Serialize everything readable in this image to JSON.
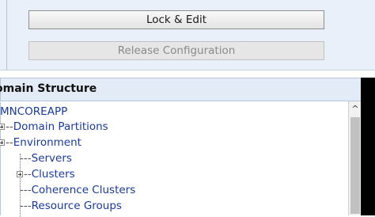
{
  "change_center": {
    "lock_edit_label": "Lock & Edit",
    "release_config_label": "Release Configuration"
  },
  "domain_structure": {
    "title": "omain Structure",
    "root": "MNCOREAPP",
    "items": [
      {
        "connector": "--",
        "label": "Domain Partitions"
      },
      {
        "connector": "--",
        "label": "Environment"
      },
      {
        "connector": "---",
        "label": "Servers"
      },
      {
        "connector": "--",
        "label": "Clusters"
      },
      {
        "connector": "---",
        "label": "Coherence Clusters"
      },
      {
        "connector": "---",
        "label": "Resource Groups"
      }
    ]
  },
  "scrollbar": {
    "up_glyph": "^"
  }
}
